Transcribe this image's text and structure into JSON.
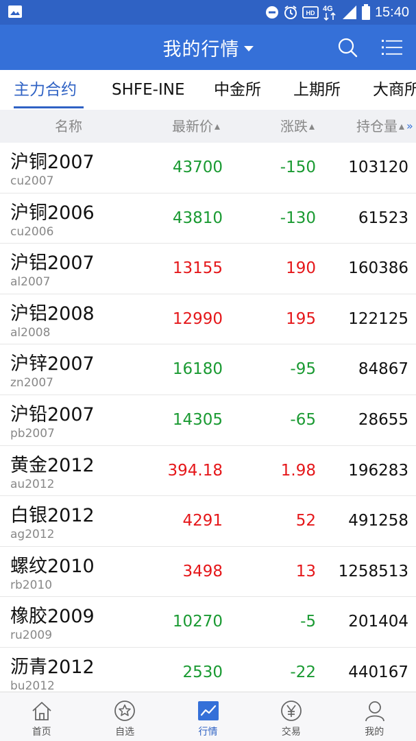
{
  "status_bar": {
    "time": "15:40",
    "network": "4G",
    "hd": "HD",
    "icons": [
      "gallery-icon",
      "do-not-disturb-icon",
      "alarm-icon",
      "hd-icon",
      "network-4g-icon",
      "signal-icon",
      "battery-icon"
    ]
  },
  "header": {
    "title": "我的行情",
    "icons": [
      "dropdown-caret-icon",
      "search-icon",
      "menu-icon"
    ]
  },
  "tabs": [
    {
      "label": "主力合约",
      "active": true
    },
    {
      "label": "SHFE-INE",
      "active": false
    },
    {
      "label": "中金所",
      "active": false
    },
    {
      "label": "上期所",
      "active": false
    },
    {
      "label": "大商所",
      "active": false
    }
  ],
  "columns": {
    "name": "名称",
    "price": "最新价",
    "change": "涨跌",
    "open_interest": "持仓量"
  },
  "colors": {
    "brand": "#3570d8",
    "up": "#e5171a",
    "down": "#1a9a32"
  },
  "rows": [
    {
      "name": "沪铜2007",
      "code": "cu2007",
      "price": "43700",
      "change": "-150",
      "oi": "103120",
      "trend": "down"
    },
    {
      "name": "沪铜2006",
      "code": "cu2006",
      "price": "43810",
      "change": "-130",
      "oi": "61523",
      "trend": "down"
    },
    {
      "name": "沪铝2007",
      "code": "al2007",
      "price": "13155",
      "change": "190",
      "oi": "160386",
      "trend": "up"
    },
    {
      "name": "沪铝2008",
      "code": "al2008",
      "price": "12990",
      "change": "195",
      "oi": "122125",
      "trend": "up"
    },
    {
      "name": "沪锌2007",
      "code": "zn2007",
      "price": "16180",
      "change": "-95",
      "oi": "84867",
      "trend": "down"
    },
    {
      "name": "沪铅2007",
      "code": "pb2007",
      "price": "14305",
      "change": "-65",
      "oi": "28655",
      "trend": "down"
    },
    {
      "name": "黄金2012",
      "code": "au2012",
      "price": "394.18",
      "change": "1.98",
      "oi": "196283",
      "trend": "up"
    },
    {
      "name": "白银2012",
      "code": "ag2012",
      "price": "4291",
      "change": "52",
      "oi": "491258",
      "trend": "up"
    },
    {
      "name": "螺纹2010",
      "code": "rb2010",
      "price": "3498",
      "change": "13",
      "oi": "1258513",
      "trend": "up"
    },
    {
      "name": "橡胶2009",
      "code": "ru2009",
      "price": "10270",
      "change": "-5",
      "oi": "201404",
      "trend": "down"
    },
    {
      "name": "沥青2012",
      "code": "bu2012",
      "price": "2530",
      "change": "-22",
      "oi": "440167",
      "trend": "down"
    }
  ],
  "bottom_nav": [
    {
      "label": "首页",
      "icon": "home-icon",
      "active": false
    },
    {
      "label": "自选",
      "icon": "star-icon",
      "active": false
    },
    {
      "label": "行情",
      "icon": "chart-icon",
      "active": true
    },
    {
      "label": "交易",
      "icon": "yen-icon",
      "active": false
    },
    {
      "label": "我的",
      "icon": "profile-icon",
      "active": false
    }
  ]
}
